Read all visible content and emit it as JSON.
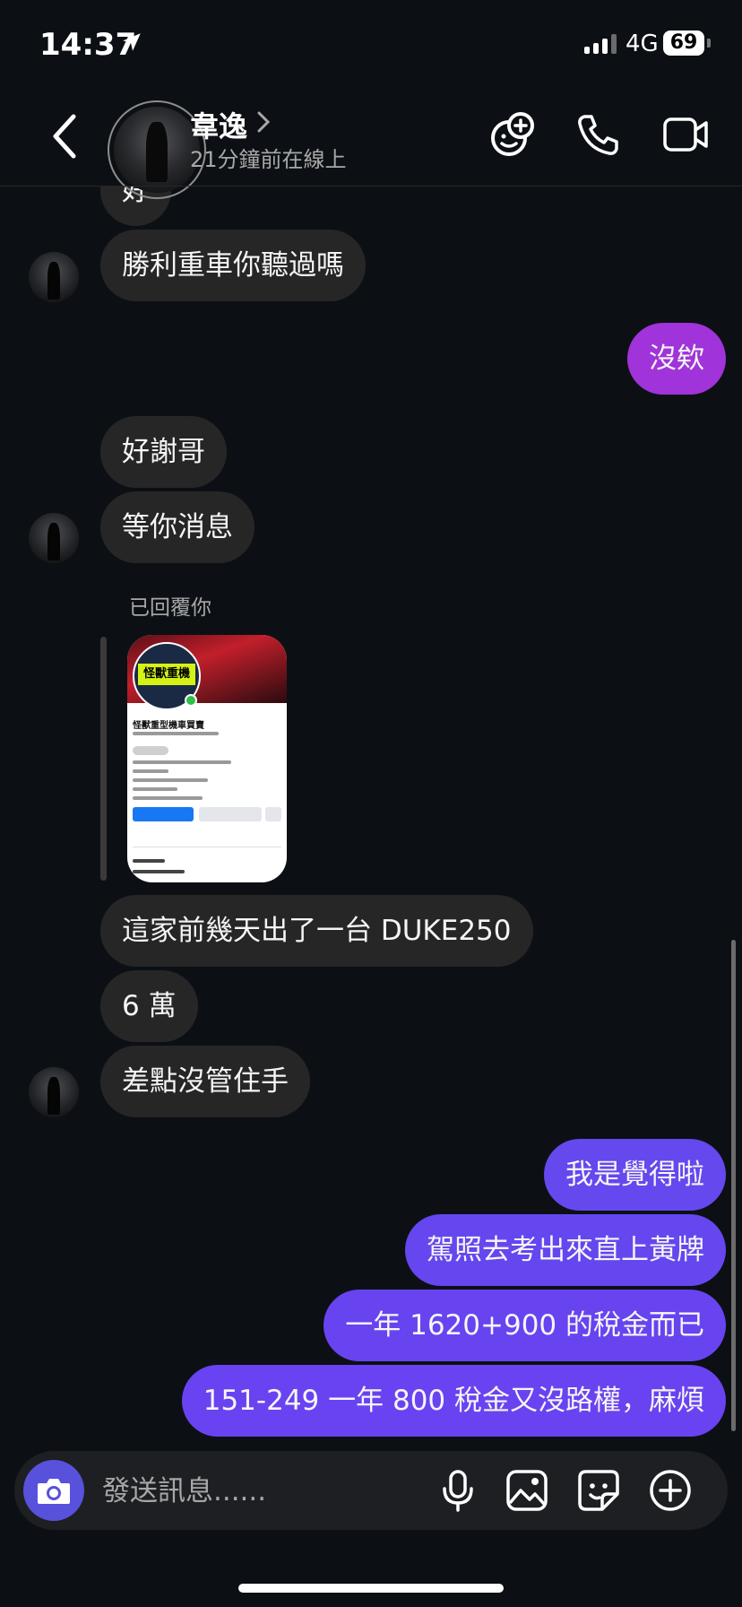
{
  "status_bar": {
    "time": "14:37",
    "network": "4G",
    "battery": "69"
  },
  "header": {
    "contact_name": "韋逸",
    "status": "21分鐘前在線上"
  },
  "messages": {
    "cut_top": "好",
    "m1": "勝利重車你聽過嗎",
    "m2": "沒欸",
    "m3": "好謝哥",
    "m4": "等你消息",
    "replied_label": "已回覆你",
    "shared_logo_text": "怪獸重機",
    "shared_page_title": "怪獸重型機車買賣",
    "m5": "這家前幾天出了一台 DUKE250",
    "m6": "6 萬",
    "m7": "差點沒管住手",
    "m8": "我是覺得啦",
    "m9": "駕照去考出來直上黃牌",
    "m10": "一年 1620+900 的稅金而已",
    "m11": "151-249 一年 800 稅金又沒路權，麻煩"
  },
  "composer": {
    "placeholder": "發送訊息......"
  },
  "colors": {
    "background": "#0c1014",
    "received_bubble": "#262626",
    "sent_purple": "#a033d9",
    "sent_violet": "#6b44f0",
    "camera_button": "#5851db"
  }
}
